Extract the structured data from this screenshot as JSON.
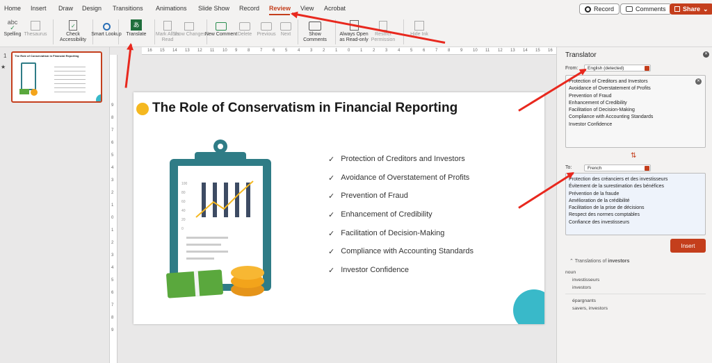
{
  "tabs": [
    "Home",
    "Insert",
    "Draw",
    "Design",
    "Transitions",
    "Animations",
    "Slide Show",
    "Record",
    "Review",
    "View",
    "Acrobat"
  ],
  "active_tab": "Review",
  "top_buttons": {
    "record": "Record",
    "comments": "Comments",
    "share": "Share"
  },
  "ribbon": [
    {
      "label": "Spelling",
      "icon": "spelling-icon"
    },
    {
      "label": "Thesaurus",
      "icon": "thesaurus-icon"
    },
    {
      "label": "Check Accessibility",
      "icon": "accessibility-icon"
    },
    {
      "label": "Smart Lookup",
      "icon": "search-icon"
    },
    {
      "label": "Translate",
      "icon": "translate-icon"
    },
    {
      "label": "Mark All as Read",
      "icon": "mark-read-icon"
    },
    {
      "label": "Show Changes",
      "icon": "changes-icon"
    },
    {
      "label": "New Comment",
      "icon": "new-comment-icon"
    },
    {
      "label": "Delete",
      "icon": "delete-comment-icon"
    },
    {
      "label": "Previous",
      "icon": "previous-comment-icon"
    },
    {
      "label": "Next",
      "icon": "next-comment-icon"
    },
    {
      "label": "Show Comments",
      "icon": "show-comments-icon"
    },
    {
      "label": "Always Open as Read-only",
      "icon": "read-only-icon"
    },
    {
      "label": "Restrict Permission",
      "icon": "permission-icon"
    },
    {
      "label": "Hide Ink",
      "icon": "hide-ink-icon"
    }
  ],
  "slide_panel": {
    "number": "1",
    "star": "★"
  },
  "slide": {
    "title": "The Role of Conservatism in Financial Reporting",
    "bullets": [
      "Protection of Creditors and Investors",
      "Avoidance of Overstatement of Profits",
      "Prevention of Fraud",
      "Enhancement of Credibility",
      "Facilitation of Decision-Making",
      "Compliance with Accounting Standards",
      "Investor Confidence"
    ],
    "check": "✓",
    "chart_axis": [
      "100",
      "80",
      "60",
      "40",
      "20",
      "0"
    ]
  },
  "ruler": {
    "h": [
      "16",
      "15",
      "14",
      "13",
      "12",
      "11",
      "10",
      "9",
      "8",
      "7",
      "6",
      "5",
      "4",
      "3",
      "2",
      "1",
      "0",
      "1",
      "2",
      "3",
      "4",
      "5",
      "6",
      "7",
      "8",
      "9",
      "10",
      "11",
      "12",
      "13",
      "14",
      "15",
      "16"
    ],
    "v": [
      "9",
      "8",
      "7",
      "6",
      "5",
      "4",
      "3",
      "2",
      "1",
      "0",
      "1",
      "2",
      "3",
      "4",
      "5",
      "6",
      "7",
      "8",
      "9"
    ]
  },
  "translator": {
    "title": "Translator",
    "from_label": "From:",
    "from_value": "English (detected)",
    "to_label": "To:",
    "to_value": "French",
    "source_lines": [
      "Protection of Creditors and Investors",
      "Avoidance of Overstatement of Profits",
      "Prevention of Fraud",
      "Enhancement of Credibility",
      "Facilitation of Decision-Making",
      "Compliance with Accounting Standards",
      "Investor Confidence"
    ],
    "target_lines": [
      "Protection des créanciers et des investisseurs",
      "Évitement de la surestimation des bénéfices",
      "Prévention de la fraude",
      "Amélioration de la crédibilité",
      "Facilitation de la prise de décisions",
      "Respect des normes comptables",
      "Confiance des investisseurs"
    ],
    "insert": "Insert",
    "translations_of": "Translations of",
    "word": "investors",
    "pos": "noun",
    "entries": [
      {
        "word": "investisseurs",
        "meaning": "investors"
      },
      {
        "word": "épargnants",
        "meaning": "savers, investors"
      }
    ]
  },
  "colors": {
    "accent": "#c43e1c",
    "annotation": "#e8281e",
    "teal": "#2f7c86"
  }
}
